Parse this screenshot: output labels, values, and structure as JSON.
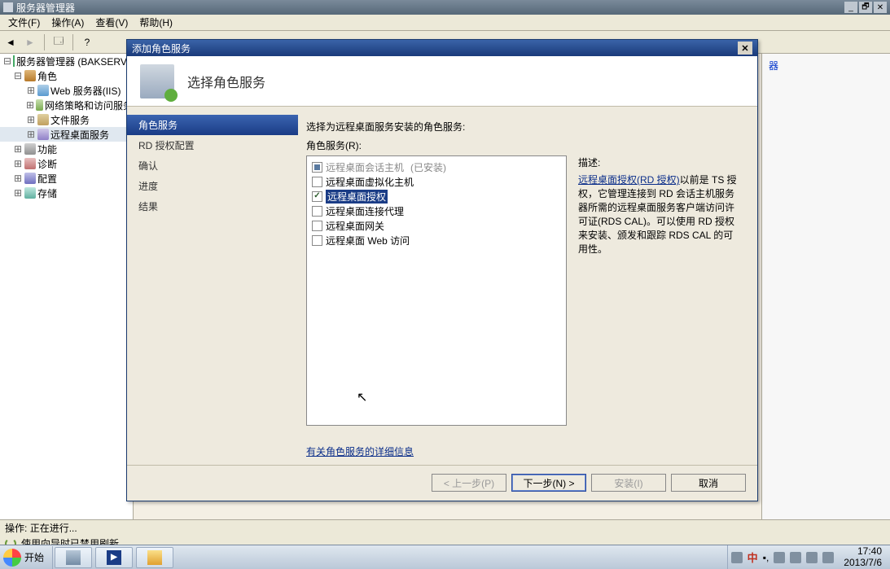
{
  "app": {
    "title": "服务器管理器",
    "menus": {
      "file": "文件(F)",
      "action": "操作(A)",
      "view": "查看(V)",
      "help": "帮助(H)"
    }
  },
  "tree": {
    "root": "服务器管理器 (BAKSERVER)",
    "roles": "角色",
    "web": "Web 服务器(IIS)",
    "net": "网络策略和访问服务",
    "file": "文件服务",
    "rds": "远程桌面服务",
    "features": "功能",
    "diag": "诊断",
    "conf": "配置",
    "stor": "存储"
  },
  "action_pane": {
    "more_ops": "器"
  },
  "statusbar": {
    "refresh_msg": "使用向导时已禁用刷新"
  },
  "bottom_status": {
    "label": "操作:",
    "text": "正在进行..."
  },
  "wizard": {
    "title": "添加角色服务",
    "heading": "选择角色服务",
    "steps": {
      "s1": "角色服务",
      "s2": "RD 授权配置",
      "s3": "确认",
      "s4": "进度",
      "s5": "结果"
    },
    "instruction": "选择为远程桌面服务安装的角色服务:",
    "list_label": "角色服务(R):",
    "items": {
      "i1": "远程桌面会话主机",
      "i1_note": "(已安装)",
      "i2": "远程桌面虚拟化主机",
      "i3": "远程桌面授权",
      "i4": "远程桌面连接代理",
      "i5": "远程桌面网关",
      "i6": "远程桌面 Web 访问"
    },
    "desc_label": "描述:",
    "desc_link": "远程桌面授权(RD 授权)",
    "desc_text": "以前是 TS 授权，它管理连接到 RD 会话主机服务器所需的远程桌面服务客户端访问许可证(RDS CAL)。可以使用 RD 授权来安装、颁发和跟踪 RDS CAL 的可用性。",
    "more_link": "有关角色服务的详细信息",
    "buttons": {
      "prev": "< 上一步(P)",
      "next": "下一步(N) >",
      "install": "安装(I)",
      "cancel": "取消"
    }
  },
  "taskbar": {
    "start": "开始",
    "lang": "中",
    "time": "17:40",
    "date": "2013/7/6"
  }
}
